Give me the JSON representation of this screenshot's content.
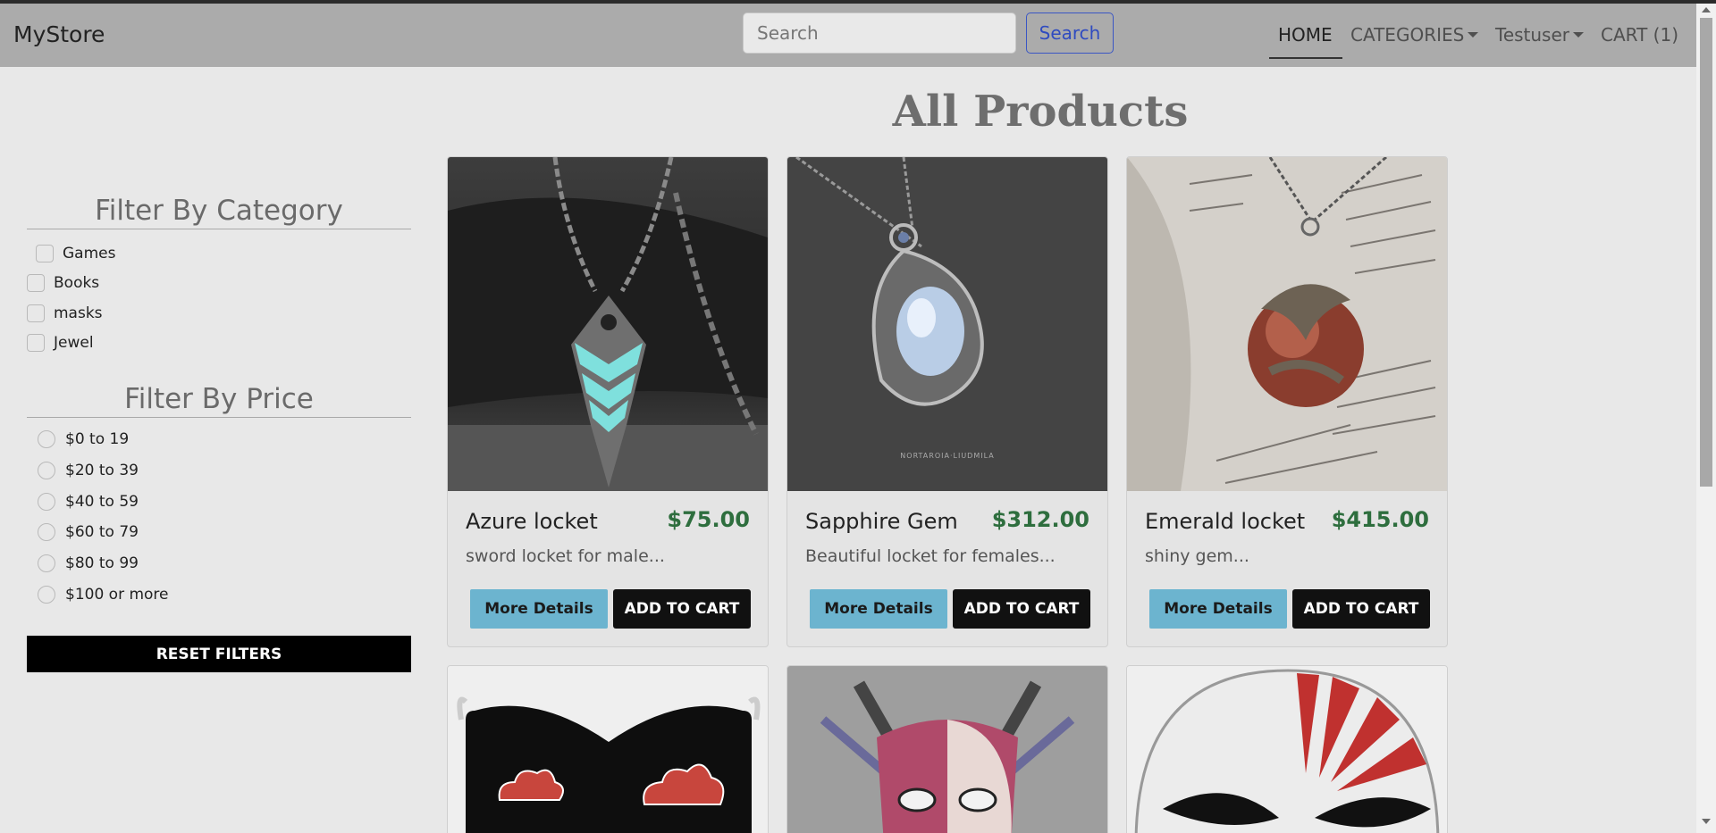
{
  "navbar": {
    "brand": "MyStore",
    "search_placeholder": "Search",
    "search_button": "Search",
    "links": {
      "home": "HOME",
      "categories": "CATEGORIES",
      "user": "Testuser",
      "cart": "CART (1)"
    }
  },
  "main": {
    "title": "All Products"
  },
  "sidebar": {
    "category_heading": "Filter By Category",
    "categories": [
      "Games",
      "Books",
      "masks",
      "Jewel"
    ],
    "price_heading": "Filter By Price",
    "prices": [
      "$0 to 19",
      "$20 to 39",
      "$40 to 59",
      "$60 to 79",
      "$80 to 99",
      "$100 or more"
    ],
    "reset_button": "RESET FILTERS"
  },
  "products": [
    {
      "name": "Azure locket",
      "price": "$75.00",
      "description": "sword locket for male...",
      "details_label": "More Details",
      "cart_label": "ADD TO CART"
    },
    {
      "name": "Sapphire Gem",
      "price": "$312.00",
      "description": "Beautiful locket for females...",
      "details_label": "More Details",
      "cart_label": "ADD TO CART"
    },
    {
      "name": "Emerald locket",
      "price": "$415.00",
      "description": "shiny gem...",
      "details_label": "More Details",
      "cart_label": "ADD TO CART"
    }
  ],
  "colors": {
    "navbar_bg": "#ababab",
    "page_bg": "#e8e8e8",
    "price_green": "#2e6e3e",
    "details_button": "#6cb4cf",
    "search_blue": "#2f4bc0"
  }
}
